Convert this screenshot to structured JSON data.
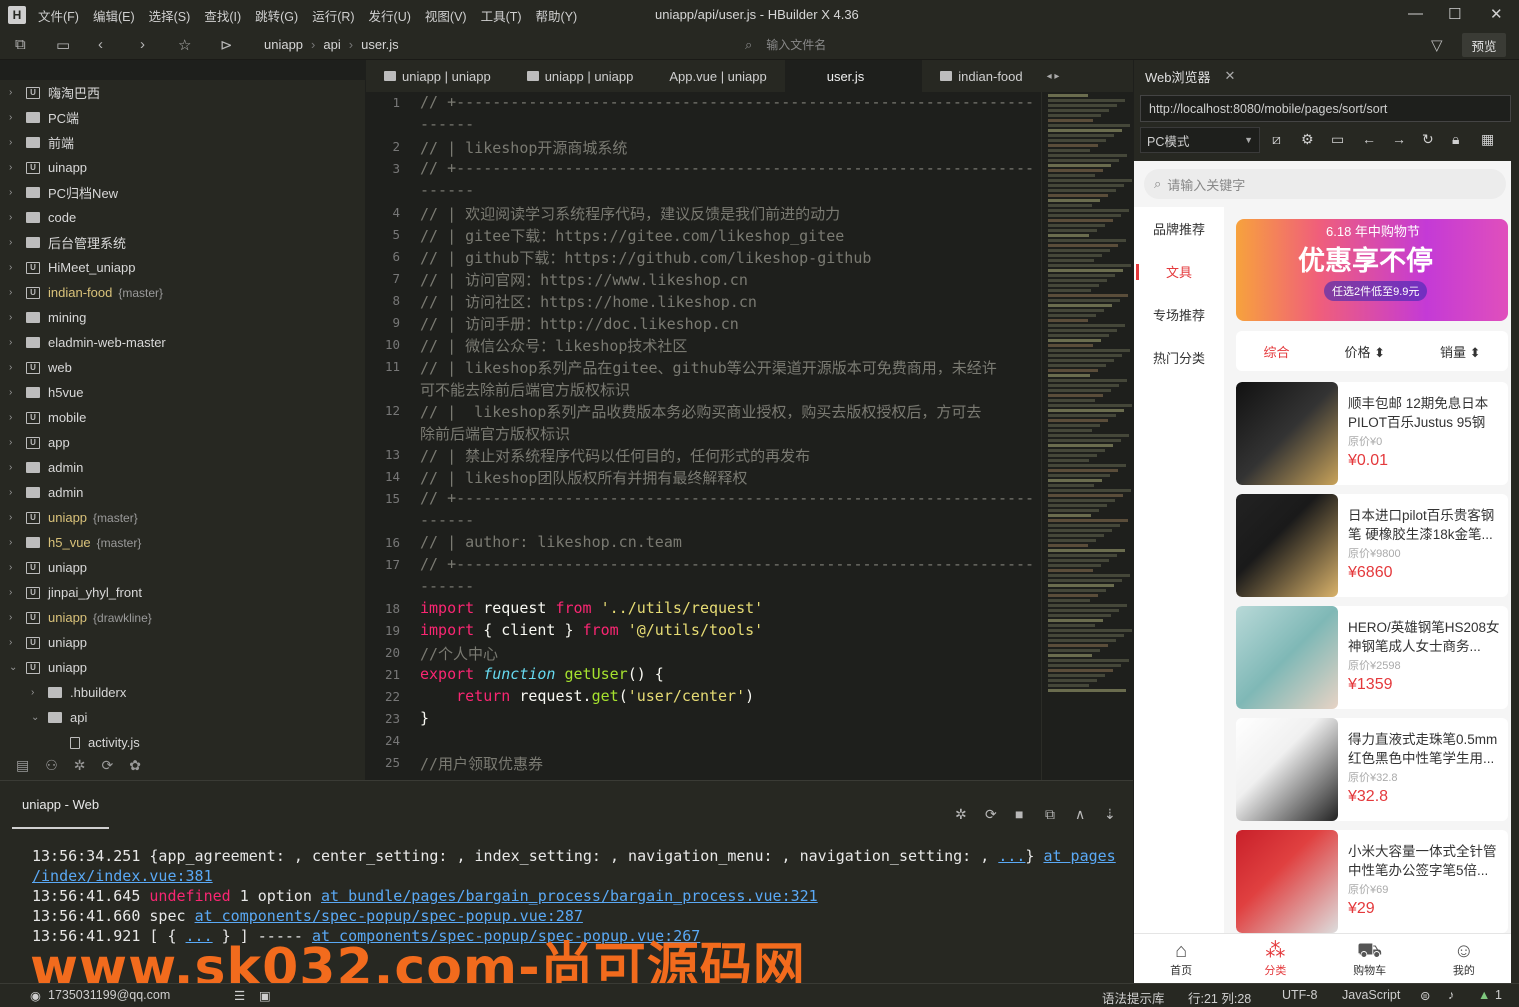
{
  "title": "uniapp/api/user.js - HBuilder X 4.36",
  "menu": [
    "文件(F)",
    "编辑(E)",
    "选择(S)",
    "查找(I)",
    "跳转(G)",
    "运行(R)",
    "发行(U)",
    "视图(V)",
    "工具(T)",
    "帮助(Y)"
  ],
  "breadcrumb": [
    "uniapp",
    "api",
    "user.js"
  ],
  "file_search_placeholder": "输入文件名",
  "preview_label": "预览",
  "tree": [
    {
      "name": "嗨淘巴西",
      "type": "u"
    },
    {
      "name": "PC端",
      "type": "f"
    },
    {
      "name": "前端",
      "type": "f"
    },
    {
      "name": "uinapp",
      "type": "u"
    },
    {
      "name": "PC归档New",
      "type": "f"
    },
    {
      "name": "code",
      "type": "f"
    },
    {
      "name": "后台管理系统",
      "type": "f"
    },
    {
      "name": "HiMeet_uniapp",
      "type": "u"
    },
    {
      "name": "indian-food",
      "type": "u",
      "branch": "{master}",
      "git": true
    },
    {
      "name": "mining",
      "type": "f"
    },
    {
      "name": "eladmin-web-master",
      "type": "f"
    },
    {
      "name": "web",
      "type": "u"
    },
    {
      "name": "h5vue",
      "type": "f"
    },
    {
      "name": "mobile",
      "type": "u"
    },
    {
      "name": "app",
      "type": "u"
    },
    {
      "name": "admin",
      "type": "f"
    },
    {
      "name": "admin",
      "type": "f"
    },
    {
      "name": "uniapp",
      "type": "u",
      "branch": "{master}",
      "git": true
    },
    {
      "name": "h5_vue",
      "type": "f",
      "branch": "{master}",
      "git": true
    },
    {
      "name": "uniapp",
      "type": "u"
    },
    {
      "name": "jinpai_yhyl_front",
      "type": "u"
    },
    {
      "name": "uniapp",
      "type": "u",
      "branch": "{drawkline}",
      "git": true
    },
    {
      "name": "uniapp",
      "type": "u"
    },
    {
      "name": "uniapp",
      "type": "u",
      "open": true
    },
    {
      "name": ".hbuilderx",
      "type": "f",
      "indent": 1
    },
    {
      "name": "api",
      "type": "f",
      "indent": 1,
      "open": true
    },
    {
      "name": "activity.js",
      "type": "file",
      "indent": 2
    }
  ],
  "tabs": [
    "uniapp | uniapp",
    "uniapp | uniapp",
    "App.vue | uniapp",
    "user.js",
    "indian-food"
  ],
  "active_tab": "user.js",
  "code_lines": [
    {
      "n": "1",
      "t": "// +----------------------------------------------------------------",
      "k": "comment"
    },
    {
      "n": "",
      "t": "------",
      "k": "comment"
    },
    {
      "n": "2",
      "t": "// | likeshop开源商城系统",
      "k": "comment"
    },
    {
      "n": "3",
      "t": "// +----------------------------------------------------------------",
      "k": "comment"
    },
    {
      "n": "",
      "t": "------",
      "k": "comment"
    },
    {
      "n": "4",
      "t": "// | 欢迎阅读学习系统程序代码，建议反馈是我们前进的动力",
      "k": "comment"
    },
    {
      "n": "5",
      "t": "// | gitee下载：https://gitee.com/likeshop_gitee",
      "k": "comment"
    },
    {
      "n": "6",
      "t": "// | github下载：https://github.com/likeshop-github",
      "k": "comment"
    },
    {
      "n": "7",
      "t": "// | 访问官网：https://www.likeshop.cn",
      "k": "comment"
    },
    {
      "n": "8",
      "t": "// | 访问社区：https://home.likeshop.cn",
      "k": "comment"
    },
    {
      "n": "9",
      "t": "// | 访问手册：http://doc.likeshop.cn",
      "k": "comment"
    },
    {
      "n": "10",
      "t": "// | 微信公众号：likeshop技术社区",
      "k": "comment"
    },
    {
      "n": "11",
      "t": "// | likeshop系列产品在gitee、github等公开渠道开源版本可免费商用，未经许",
      "k": "comment"
    },
    {
      "n": "",
      "t": "可不能去除前后端官方版权标识",
      "k": "comment"
    },
    {
      "n": "12",
      "t": "// |  likeshop系列产品收费版本务必购买商业授权，购买去版权授权后，方可去",
      "k": "comment"
    },
    {
      "n": "",
      "t": "除前后端官方版权标识",
      "k": "comment"
    },
    {
      "n": "13",
      "t": "// | 禁止对系统程序代码以任何目的，任何形式的再发布",
      "k": "comment"
    },
    {
      "n": "14",
      "t": "// | likeshop团队版权所有并拥有最终解释权",
      "k": "comment"
    },
    {
      "n": "15",
      "t": "// +----------------------------------------------------------------",
      "k": "comment"
    },
    {
      "n": "",
      "t": "------",
      "k": "comment"
    },
    {
      "n": "16",
      "t": "// | author: likeshop.cn.team",
      "k": "comment"
    },
    {
      "n": "17",
      "t": "// +----------------------------------------------------------------",
      "k": "comment"
    },
    {
      "n": "",
      "t": "------",
      "k": "comment"
    },
    {
      "n": "18",
      "t": "import request from '../utils/request'",
      "k": "import1"
    },
    {
      "n": "19",
      "t": "import { client } from '@/utils/tools'",
      "k": "import2"
    },
    {
      "n": "20",
      "t": "//个人中心",
      "k": "comment"
    },
    {
      "n": "21",
      "t": "export function getUser() {",
      "k": "export"
    },
    {
      "n": "22",
      "t": "    return request.get('user/center')",
      "k": "return"
    },
    {
      "n": "23",
      "t": "}",
      "k": "plain"
    },
    {
      "n": "24",
      "t": "",
      "k": "plain"
    },
    {
      "n": "25",
      "t": "//用户领取优惠券",
      "k": "comment"
    }
  ],
  "browser": {
    "tab_label": "Web浏览器",
    "url": "http://localhost:8080/mobile/pages/sort/sort",
    "mode": "PC模式",
    "search_placeholder": "请输入关键字",
    "categories": [
      "品牌推荐",
      "文具",
      "专场推荐",
      "热门分类"
    ],
    "active_category": "文具",
    "banner": {
      "top": "6.18 年中购物节",
      "main": "优惠享不停",
      "sub": "任选2件低至9.9元"
    },
    "sort": [
      "综合",
      "价格 ⬍",
      "销量 ⬍"
    ],
    "products": [
      {
        "name": "顺丰包邮 12期免息日本PILOT百乐Justus 95钢笔...",
        "orig": "原价¥0",
        "price": "¥0.01"
      },
      {
        "name": "日本进口pilot百乐贵客钢笔 硬橡胶生漆18k金笔...",
        "orig": "原价¥9800",
        "price": "¥6860"
      },
      {
        "name": "HERO/英雄钢笔HS208女神钢笔成人女士商务...",
        "orig": "原价¥2598",
        "price": "¥1359"
      },
      {
        "name": "得力直液式走珠笔0.5mm红色黑色中性笔学生用...",
        "orig": "原价¥32.8",
        "price": "¥32.8"
      },
      {
        "name": "小米大容量一体式全针管中性笔办公签字笔5倍...",
        "orig": "原价¥69",
        "price": "¥29"
      }
    ],
    "tabbar": [
      {
        "label": "首页",
        "icon": "home-icon"
      },
      {
        "label": "分类",
        "icon": "category-icon"
      },
      {
        "label": "购物车",
        "icon": "cart-icon"
      },
      {
        "label": "我的",
        "icon": "user-icon"
      }
    ],
    "active_tabbar": "分类"
  },
  "console": {
    "tab": "uniapp - Web",
    "lines": [
      {
        "time": "13:56:34.251",
        "text": "{app_agreement: , center_setting: , index_setting: , navigation_menu: , navigation_setting: , ",
        "link1": "...",
        "mid": "} ",
        "link2": "at pages"
      },
      {
        "time": "",
        "text": "",
        "link1": "/index/index.vue:381",
        "mid": "",
        "link2": ""
      },
      {
        "time": "13:56:41.645",
        "undef": "undefined",
        "text": " 1 option ",
        "link1": "at bundle/pages/bargain_process/bargain_process.vue:321",
        "mid": "",
        "link2": ""
      },
      {
        "time": "13:56:41.660",
        "text": "spec ",
        "link1": "at components/spec-popup/spec-popup.vue:287",
        "mid": "",
        "link2": ""
      },
      {
        "time": "13:56:41.921",
        "text": "[ { ",
        "link1": "...",
        "mid": " } ] ----- ",
        "link2": "at components/spec-popup/spec-popup.vue:267"
      }
    ]
  },
  "statusbar": {
    "user": "1735031199@qq.com",
    "hint": "语法提示库",
    "pos": "行:21  列:28",
    "encoding": "UTF-8",
    "lang": "JavaScript",
    "count": "1"
  },
  "watermark": "www.sk032.com-尚可源码网"
}
